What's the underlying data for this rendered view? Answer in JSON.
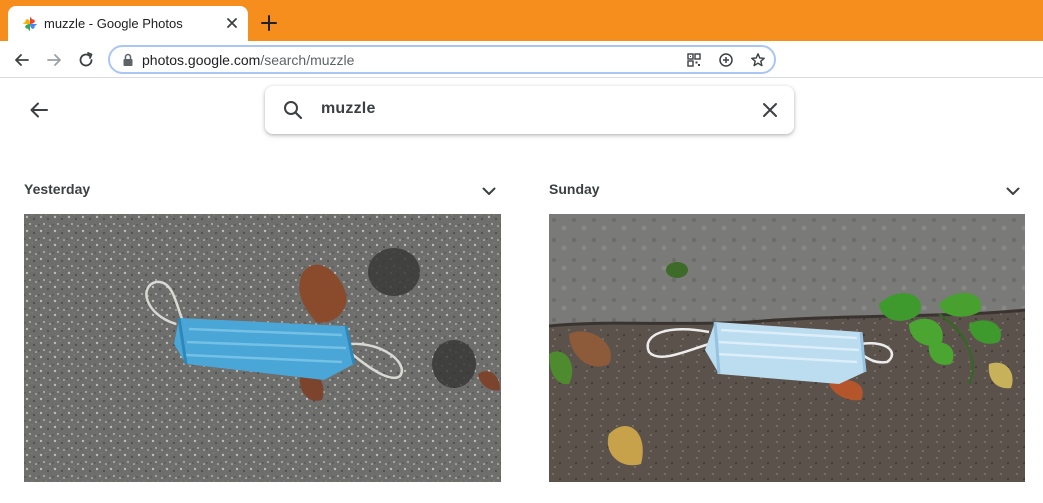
{
  "browser": {
    "tab_title": "muzzle - Google Photos",
    "url_domain": "photos.google.com",
    "url_path": "/search/muzzle"
  },
  "search": {
    "query": "muzzle"
  },
  "sections": [
    {
      "label": "Yesterday"
    },
    {
      "label": "Sunday"
    }
  ],
  "colors": {
    "tabstrip": "#f68e1e",
    "omnibox_border": "#a9c6f5",
    "mask_blue": "#4aa6d6",
    "mask_light": "#bcdcf0"
  }
}
